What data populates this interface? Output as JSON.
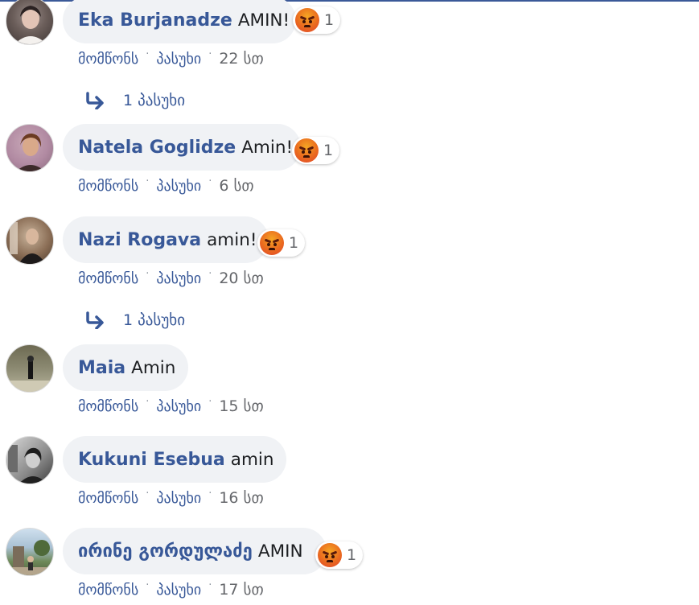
{
  "colors": {
    "author": "#385898",
    "bubble_bg": "#f0f2f5",
    "meta": "#65676b",
    "topline": "#3b5998"
  },
  "actions": {
    "like_label": "მომწონს",
    "reply_label": "პასუხი"
  },
  "comments": [
    {
      "author": "Eka Burjanadze",
      "text": "AMIN!",
      "reaction": "angry-icon",
      "reaction_count": "1",
      "time": "22 სთ",
      "replies_label": "1 პასუხი"
    },
    {
      "author": "Natela Goglidze",
      "text": "Amin!",
      "reaction": "angry-icon",
      "reaction_count": "1",
      "time": "6 სთ"
    },
    {
      "author": "Nazi Rogava",
      "text": "amin!",
      "reaction": "angry-icon",
      "reaction_count": "1",
      "time": "20 სთ",
      "replies_label": "1 პასუხი"
    },
    {
      "author": "Maia",
      "text": "Amin",
      "time": "15 სთ"
    },
    {
      "author": "Kukuni Esebua",
      "text": "amin",
      "time": "16 სთ"
    },
    {
      "author": "ირინე გორდულაძე",
      "text": "AMIN",
      "reaction": "angry-icon",
      "reaction_count": "1",
      "time": "17 სთ"
    }
  ]
}
